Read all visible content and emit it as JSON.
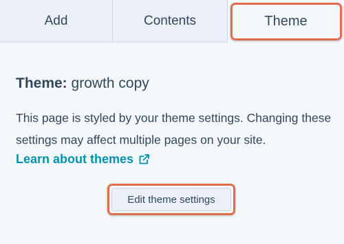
{
  "tabs": [
    {
      "label": "Add"
    },
    {
      "label": "Contents"
    },
    {
      "label": "Theme"
    }
  ],
  "theme": {
    "prefix": "Theme:",
    "name": "growth copy"
  },
  "description": "This page is styled by your theme settings. Changing these settings may affect multiple pages on your site.",
  "learn_link": {
    "label": "Learn about themes",
    "icon": "external-link-icon"
  },
  "edit_button": {
    "label": "Edit theme settings"
  },
  "colors": {
    "accent_link": "#0091ae",
    "highlight": "#e06c4a",
    "text": "#33475b"
  }
}
